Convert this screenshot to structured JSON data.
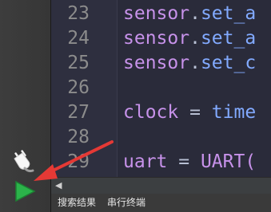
{
  "toolbar": {
    "connect_icon": "plug-icon",
    "run_icon": "play-icon"
  },
  "editor": {
    "lines": [
      {
        "num": "23",
        "tokens": [
          {
            "t": "sensor",
            "c": "id"
          },
          {
            "t": ".",
            "c": "op"
          },
          {
            "t": "set_a",
            "c": "fn"
          }
        ]
      },
      {
        "num": "24",
        "tokens": [
          {
            "t": "sensor",
            "c": "id"
          },
          {
            "t": ".",
            "c": "op"
          },
          {
            "t": "set_a",
            "c": "fn"
          }
        ]
      },
      {
        "num": "25",
        "tokens": [
          {
            "t": "sensor",
            "c": "id"
          },
          {
            "t": ".",
            "c": "op"
          },
          {
            "t": "set_c",
            "c": "fn"
          }
        ]
      },
      {
        "num": "26",
        "tokens": []
      },
      {
        "num": "27",
        "tokens": [
          {
            "t": "clock",
            "c": "id"
          },
          {
            "t": " = ",
            "c": "op"
          },
          {
            "t": "time",
            "c": "fn"
          }
        ]
      },
      {
        "num": "28",
        "tokens": []
      },
      {
        "num": "29",
        "tokens": [
          {
            "t": "uart",
            "c": "id"
          },
          {
            "t": " = ",
            "c": "op"
          },
          {
            "t": "UART(",
            "c": "kw"
          }
        ]
      }
    ]
  },
  "scrollbar": {
    "left_arrow": "◀"
  },
  "tabs": {
    "search_results": "搜索结果",
    "serial_terminal": "串行终端"
  },
  "colors": {
    "annotation_arrow": "#e53935",
    "run_green": "#2bb34a"
  }
}
